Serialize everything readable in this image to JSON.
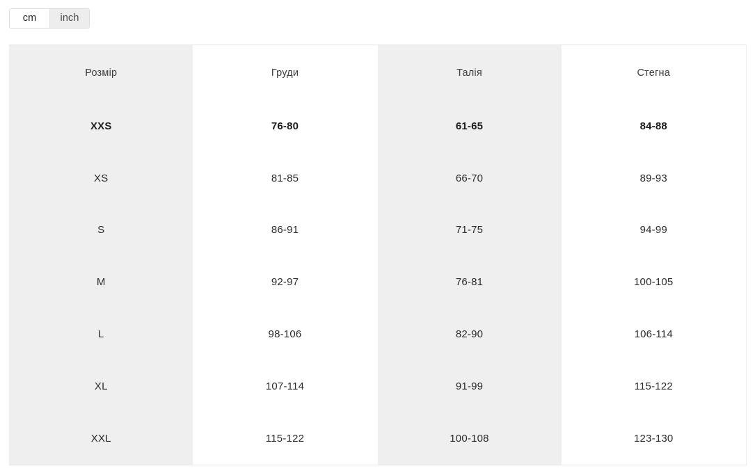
{
  "unit_toggle": {
    "options": [
      {
        "label": "cm",
        "active": true
      },
      {
        "label": "inch",
        "active": false
      }
    ],
    "selected": "cm"
  },
  "size_table": {
    "columns": [
      {
        "header": "Розмір",
        "shaded": true
      },
      {
        "header": "Груди",
        "shaded": false
      },
      {
        "header": "Талія",
        "shaded": true
      },
      {
        "header": "Стегна",
        "shaded": false
      }
    ],
    "rows": [
      {
        "size": "XXS",
        "chest": "76-80",
        "waist": "61-65",
        "hips": "84-88",
        "bold": true
      },
      {
        "size": "XS",
        "chest": "81-85",
        "waist": "66-70",
        "hips": "89-93",
        "bold": false
      },
      {
        "size": "S",
        "chest": "86-91",
        "waist": "71-75",
        "hips": "94-99",
        "bold": false
      },
      {
        "size": "M",
        "chest": "92-97",
        "waist": "76-81",
        "hips": "100-105",
        "bold": false
      },
      {
        "size": "L",
        "chest": "98-106",
        "waist": "82-90",
        "hips": "106-114",
        "bold": false
      },
      {
        "size": "XL",
        "chest": "107-114",
        "waist": "91-99",
        "hips": "115-122",
        "bold": false
      },
      {
        "size": "XXL",
        "chest": "115-122",
        "waist": "100-108",
        "hips": "123-130",
        "bold": false
      }
    ]
  },
  "colors": {
    "shaded_column": "#efefef",
    "plain_column": "#ffffff",
    "row_divider": "#e9e9e9",
    "header_divider": "#dadada",
    "toggle_active_bg": "#ffffff",
    "toggle_inactive_bg": "#ededed",
    "toggle_border": "#dcdcdc",
    "text": "#2b2b2b"
  }
}
